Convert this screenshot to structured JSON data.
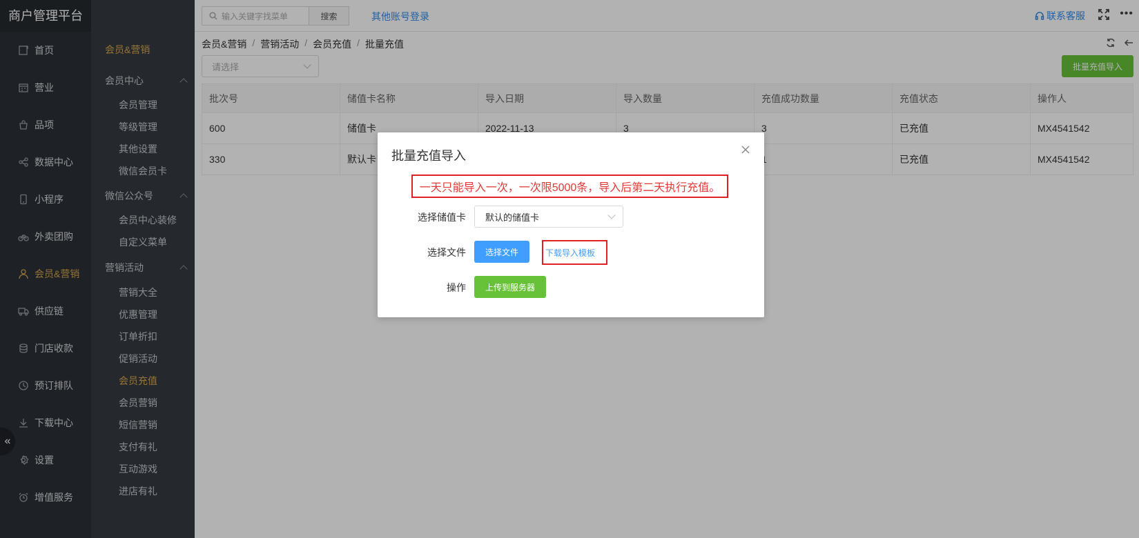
{
  "app": {
    "title": "商户管理平台"
  },
  "nav": [
    {
      "label": "首页",
      "icon": "home-icon"
    },
    {
      "label": "营业",
      "icon": "calendar-icon"
    },
    {
      "label": "品项",
      "icon": "bag-icon"
    },
    {
      "label": "数据中心",
      "icon": "share-icon"
    },
    {
      "label": "小程序",
      "icon": "mobile-icon"
    },
    {
      "label": "外卖团购",
      "icon": "bike-icon"
    },
    {
      "label": "会员&营销",
      "icon": "user-icon",
      "active": true
    },
    {
      "label": "供应链",
      "icon": "truck-icon"
    },
    {
      "label": "门店收款",
      "icon": "database-icon"
    },
    {
      "label": "预订排队",
      "icon": "clock-icon"
    },
    {
      "label": "下载中心",
      "icon": "download-icon"
    },
    {
      "label": "设置",
      "icon": "gear-icon"
    },
    {
      "label": "增值服务",
      "icon": "alarm-icon"
    }
  ],
  "subnav": {
    "title": "会员&营销",
    "groups": [
      {
        "label": "会员中心",
        "items": [
          "会员管理",
          "等级管理",
          "其他设置",
          "微信会员卡"
        ]
      },
      {
        "label": "微信公众号",
        "items": [
          "会员中心装修",
          "自定义菜单"
        ]
      },
      {
        "label": "营销活动",
        "items": [
          "营销大全",
          "优惠管理",
          "订单折扣",
          "促销活动",
          "会员充值",
          "会员营销",
          "短信营销",
          "支付有礼",
          "互动游戏",
          "进店有礼"
        ]
      }
    ],
    "active_item": "会员充值"
  },
  "topbar": {
    "search_placeholder": "输入关键字找菜单",
    "search_button": "搜索",
    "other_login": "其他账号登录",
    "service": "联系客服",
    "more": "•••"
  },
  "breadcrumb": [
    "会员&营销",
    "营销活动",
    "会员充值",
    "批量充值"
  ],
  "filter": {
    "placeholder": "请选择"
  },
  "import_button": "批量充值导入",
  "table": {
    "headers": [
      "批次号",
      "储值卡名称",
      "导入日期",
      "导入数量",
      "充值成功数量",
      "充值状态",
      "操作人"
    ],
    "rows": [
      [
        "600",
        "储值卡",
        "2022-11-13",
        "3",
        "3",
        "已充值",
        "MX4541542"
      ],
      [
        "330",
        "默认卡",
        "",
        "",
        "1",
        "已充值",
        "MX4541542"
      ]
    ]
  },
  "modal": {
    "title": "批量充值导入",
    "warning": "一天只能导入一次，一次限5000条，导入后第二天执行充值。",
    "card_label": "选择储值卡",
    "card_value": "默认的储值卡",
    "file_label": "选择文件",
    "file_button": "选择文件",
    "template_link": "下载导入模板",
    "action_label": "操作",
    "upload_button": "上传到服务器"
  },
  "colors": {
    "accent": "#d8a84e",
    "primary": "#409eff",
    "success": "#67c23a",
    "alert": "#e02020"
  }
}
